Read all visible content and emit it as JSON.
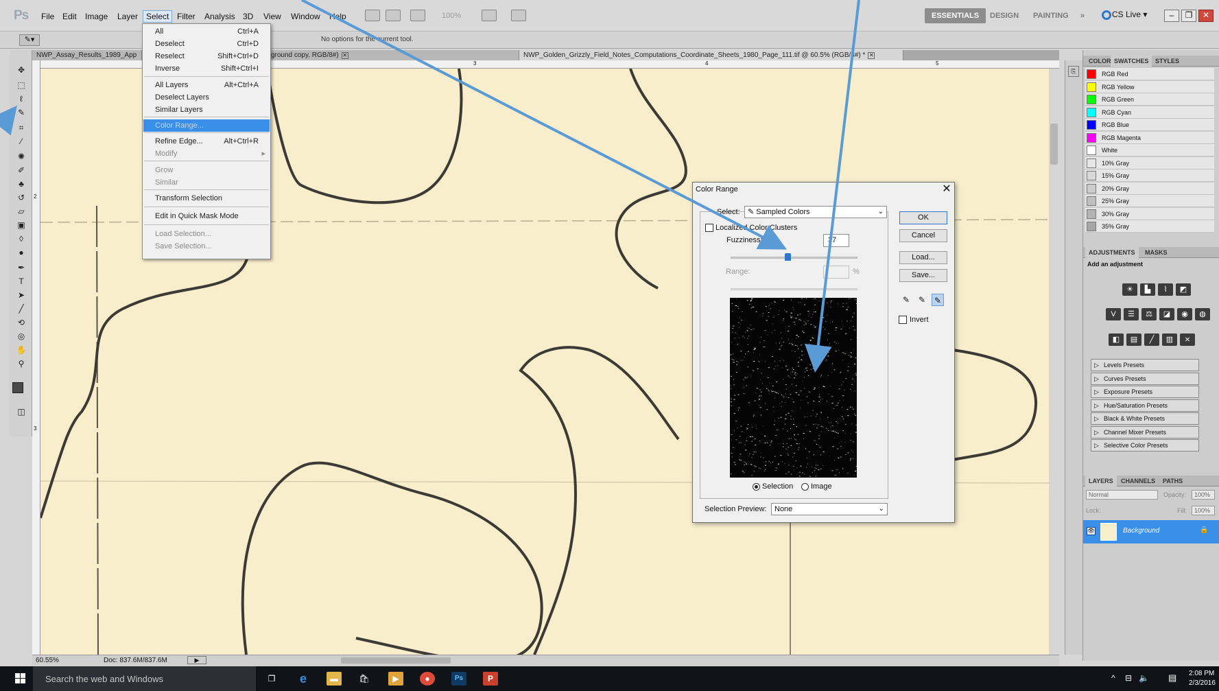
{
  "app": {
    "logo": "Ps",
    "menu": [
      "File",
      "Edit",
      "Image",
      "Layer",
      "Select",
      "Filter",
      "Analysis",
      "3D",
      "View",
      "Window",
      "Help"
    ],
    "active_menu": "Select",
    "zoom_menu": "100%",
    "workspaces": [
      "ESSENTIALS",
      "DESIGN",
      "PAINTING",
      "»"
    ],
    "cslive": "CS Live ▾",
    "window_buttons": [
      "–",
      "❐",
      "✕"
    ]
  },
  "options_bar": {
    "text": "No options for the current tool."
  },
  "tabs": [
    {
      "label": "NWP_Assay_Results_1989_App"
    },
    {
      "label": "thru_89_465_Page_1.jpg @ 103% (Background copy, RGB/8#)"
    },
    {
      "label": "NWP_Golden_Grizzly_Field_Notes_Computations_Coordinate_Sheets_1980_Page_111.tif @ 60.5% (RGB/8#) *"
    }
  ],
  "ruler": {
    "marks": [
      "3",
      "4",
      "5"
    ],
    "side_marks": [
      "2",
      "3"
    ]
  },
  "status": {
    "zoom": "60.55%",
    "doc_size": "Doc: 837.6M/837.6M"
  },
  "select_menu": {
    "items": [
      {
        "label": "All",
        "shortcut": "Ctrl+A"
      },
      {
        "label": "Deselect",
        "shortcut": "Ctrl+D"
      },
      {
        "label": "Reselect",
        "shortcut": "Shift+Ctrl+D"
      },
      {
        "label": "Inverse",
        "shortcut": "Shift+Ctrl+I"
      },
      {
        "label": "All Layers",
        "shortcut": "Alt+Ctrl+A"
      },
      {
        "label": "Deselect Layers",
        "shortcut": ""
      },
      {
        "label": "Similar Layers",
        "shortcut": ""
      },
      {
        "label": "Color Range...",
        "shortcut": ""
      },
      {
        "label": "Refine Edge...",
        "shortcut": "Alt+Ctrl+R"
      },
      {
        "label": "Modify",
        "shortcut": ""
      },
      {
        "label": "Grow",
        "shortcut": ""
      },
      {
        "label": "Similar",
        "shortcut": ""
      },
      {
        "label": "Transform Selection",
        "shortcut": ""
      },
      {
        "label": "Edit in Quick Mask Mode",
        "shortcut": ""
      },
      {
        "label": "Load Selection...",
        "shortcut": ""
      },
      {
        "label": "Save Selection...",
        "shortcut": ""
      }
    ]
  },
  "dialog": {
    "title": "Color Range",
    "close": "✕",
    "select_label": "Select:",
    "select_value": "Sampled Colors",
    "localized_label": "Localized Color Clusters",
    "fuzziness_label": "Fuzziness:",
    "fuzziness_value": "37",
    "range_label": "Range:",
    "range_unit": "%",
    "fuzziness_fraction": 0.45,
    "buttons": {
      "ok": "OK",
      "cancel": "Cancel",
      "load": "Load...",
      "save": "Save..."
    },
    "invert_label": "Invert",
    "radio_selection": "Selection",
    "radio_image": "Image",
    "preview_label": "Selection Preview:",
    "preview_value": "None"
  },
  "swatches_panel": {
    "tabs": [
      "COLOR",
      "SWATCHES",
      "STYLES"
    ],
    "swatches": [
      {
        "name": "RGB Red",
        "color": "#ff0000"
      },
      {
        "name": "RGB Yellow",
        "color": "#ffff00"
      },
      {
        "name": "RGB Green",
        "color": "#00ff00"
      },
      {
        "name": "RGB Cyan",
        "color": "#00ffff"
      },
      {
        "name": "RGB Blue",
        "color": "#0000ff"
      },
      {
        "name": "RGB Magenta",
        "color": "#ff00ff"
      },
      {
        "name": "White",
        "color": "#ffffff"
      },
      {
        "name": "10% Gray",
        "color": "#e6e6e6"
      },
      {
        "name": "15% Gray",
        "color": "#d9d9d9"
      },
      {
        "name": "20% Gray",
        "color": "#cccccc"
      },
      {
        "name": "25% Gray",
        "color": "#bfbfbf"
      },
      {
        "name": "30% Gray",
        "color": "#b3b3b3"
      },
      {
        "name": "35% Gray",
        "color": "#a6a6a6"
      }
    ]
  },
  "adjustments_panel": {
    "tabs": [
      "ADJUSTMENTS",
      "MASKS"
    ],
    "heading": "Add an adjustment",
    "presets": [
      "Levels Presets",
      "Curves Presets",
      "Exposure Presets",
      "Hue/Saturation Presets",
      "Black & White Presets",
      "Channel Mixer Presets",
      "Selective Color Presets"
    ]
  },
  "layers_panel": {
    "tabs": [
      "LAYERS",
      "CHANNELS",
      "PATHS"
    ],
    "blend_mode": "Normal",
    "opacity_label": "Opacity:",
    "opacity": "100%",
    "lock_label": "Lock:",
    "fill_label": "Fill:",
    "fill": "100%",
    "layer_name": "Background"
  },
  "taskbar": {
    "search": "Search the web and Windows",
    "time": "2:08 PM",
    "date": "2/3/2016"
  },
  "colors": {
    "accent": "#3a8fe8",
    "paper": "#f8eecc",
    "arrow": "#5b9bd5",
    "ink": "#333333"
  }
}
